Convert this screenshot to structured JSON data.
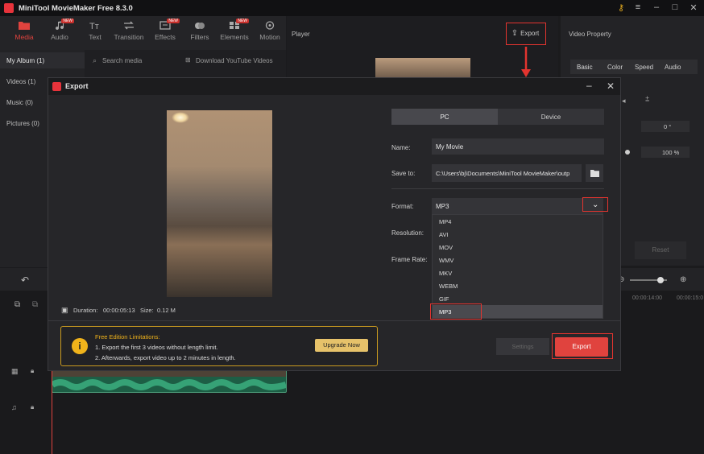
{
  "app": {
    "title": "MiniTool MovieMaker Free 8.3.0"
  },
  "toolbar": {
    "tools": [
      {
        "label": "Media",
        "icon": "folder-icon",
        "badge": ""
      },
      {
        "label": "Audio",
        "icon": "music-note-icon",
        "badge": "NEW"
      },
      {
        "label": "Text",
        "icon": "text-icon",
        "badge": ""
      },
      {
        "label": "Transition",
        "icon": "transition-icon",
        "badge": ""
      },
      {
        "label": "Effects",
        "icon": "effects-icon",
        "badge": "NEW"
      },
      {
        "label": "Filters",
        "icon": "filters-icon",
        "badge": ""
      },
      {
        "label": "Elements",
        "icon": "elements-icon",
        "badge": "NEW"
      },
      {
        "label": "Motion",
        "icon": "motion-icon",
        "badge": ""
      }
    ]
  },
  "left_panel": {
    "items": [
      "My Album (1)",
      "Videos (1)",
      "Music (0)",
      "Pictures (0)"
    ]
  },
  "media_panel": {
    "search_placeholder": "Search media",
    "download_label": "Download YouTube Videos"
  },
  "player": {
    "label": "Player",
    "export_label": "Export"
  },
  "video_property": {
    "label": "Video Property",
    "tabs": [
      "Basic",
      "Color",
      "Speed",
      "Audio"
    ],
    "rotation_value": "0 °",
    "scale_value": "100 %",
    "reset_label": "Reset"
  },
  "timeline": {
    "time_a": "00:00:14:00",
    "time_b": "00:00:15:0"
  },
  "export_dialog": {
    "title": "Export",
    "duration_label": "Duration:",
    "duration_value": "00:00:05:13",
    "size_label": "Size:",
    "size_value": "0.12 M",
    "tabs": [
      "PC",
      "Device"
    ],
    "name_label": "Name:",
    "name_value": "My Movie",
    "save_to_label": "Save to:",
    "save_to_value": "C:\\Users\\bj\\Documents\\MiniTool MovieMaker\\outp",
    "format_label": "Format:",
    "format_value": "MP3",
    "resolution_label": "Resolution:",
    "frame_rate_label": "Frame Rate:",
    "format_options": [
      "MP4",
      "AVI",
      "MOV",
      "WMV",
      "MKV",
      "WEBM",
      "GIF",
      "MP3"
    ],
    "selected_format": "MP3",
    "limitations": {
      "title": "Free Edition Limitations:",
      "line1": "1. Export the first 3 videos without length limit.",
      "line2": "2. Afterwards, export video up to 2 minutes in length.",
      "upgrade_label": "Upgrade Now"
    },
    "settings_label": "Settings",
    "export_button_label": "Export"
  },
  "colors": {
    "accent": "#e0433e",
    "highlight": "#e3342f",
    "warning": "#f0b31b"
  }
}
